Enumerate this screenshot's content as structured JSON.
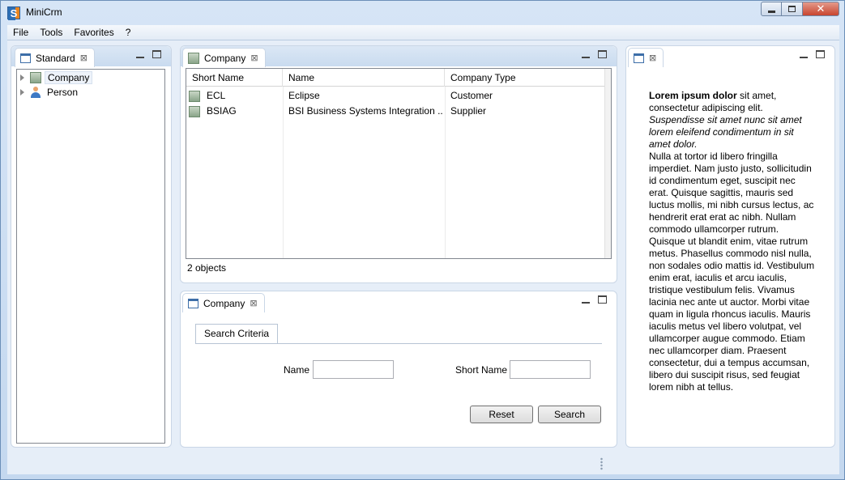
{
  "window": {
    "title": "MiniCrm",
    "icon_letter": "S",
    "controls": {
      "minimize": "minimize-icon",
      "maximize": "maximize-icon",
      "close": "✕"
    }
  },
  "menu": [
    "File",
    "Tools",
    "Favorites",
    "?"
  ],
  "nav_view": {
    "tab_label": "Standard",
    "tree": [
      {
        "label": "Company",
        "icon": "building-icon",
        "selected": true
      },
      {
        "label": "Person",
        "icon": "person-icon",
        "selected": false
      }
    ]
  },
  "table_view": {
    "tab_label": "Company",
    "columns": [
      "Short Name",
      "Name",
      "Company Type"
    ],
    "rows": [
      {
        "short_name": "ECL",
        "name": "Eclipse",
        "type": "Customer"
      },
      {
        "short_name": "BSIAG",
        "name": "BSI Business Systems Integration ...",
        "type": "Supplier"
      }
    ],
    "status": "2 objects"
  },
  "search_view": {
    "tab_label": "Company",
    "form_tab": "Search Criteria",
    "fields": {
      "name_label": "Name",
      "name_value": "",
      "short_name_label": "Short Name",
      "short_name_value": ""
    },
    "buttons": {
      "reset": "Reset",
      "search": "Search"
    }
  },
  "text_view": {
    "bold": "Lorem ipsum dolor",
    "intro": " sit amet, consectetur adipiscing elit.",
    "italic": "Suspendisse sit amet nunc sit amet lorem eleifend condimentum in sit amet dolor.",
    "body": "Nulla at tortor id libero fringilla imperdiet. Nam justo justo, sollicitudin id condimentum eget, suscipit nec erat. Quisque sagittis, mauris sed luctus mollis, mi nibh cursus lectus, ac hendrerit erat erat ac nibh. Nullam commodo ullamcorper rutrum. Quisque ut blandit enim, vitae rutrum metus. Phasellus commodo nisl nulla, non sodales odio mattis id. Vestibulum enim erat, iaculis et arcu iaculis, tristique vestibulum felis. Vivamus lacinia nec ante ut auctor. Morbi vitae quam in ligula rhoncus iaculis. Mauris iaculis metus vel libero volutpat, vel ullamcorper augue commodo. Etiam nec ullamcorper diam. Praesent consectetur, dui a tempus accumsan, libero dui suscipit risus, sed feugiat lorem nibh at tellus."
  }
}
